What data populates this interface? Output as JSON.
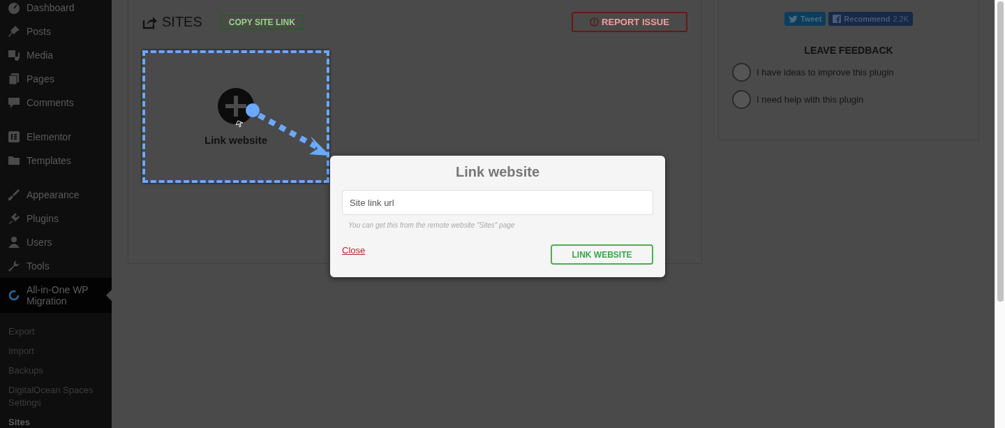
{
  "sidebar": {
    "menu_groups": [
      [
        {
          "label": "Dashboard",
          "selected": false
        },
        {
          "label": "Posts",
          "selected": false
        },
        {
          "label": "Media",
          "selected": false
        },
        {
          "label": "Pages",
          "selected": false
        },
        {
          "label": "Comments",
          "selected": false
        }
      ],
      [
        {
          "label": "Elementor",
          "selected": false
        },
        {
          "label": "Templates",
          "selected": false
        }
      ],
      [
        {
          "label": "Appearance",
          "selected": false
        },
        {
          "label": "Plugins",
          "selected": false
        },
        {
          "label": "Users",
          "selected": false
        },
        {
          "label": "Tools",
          "selected": false
        },
        {
          "label": "All-in-One WP Migration",
          "selected": true
        }
      ]
    ],
    "submenu": [
      {
        "label": "Export",
        "selected": false
      },
      {
        "label": "Import",
        "selected": false
      },
      {
        "label": "Backups",
        "selected": false
      },
      {
        "label": "DigitalOcean Spaces Settings",
        "selected": false
      },
      {
        "label": "Sites",
        "selected": true
      }
    ]
  },
  "sites_panel": {
    "title": "SITES",
    "copy_button": "COPY SITE LINK",
    "report_button": "REPORT ISSUE",
    "link_card": {
      "label": "Link website"
    }
  },
  "feedback_panel": {
    "tweet_button": "Tweet",
    "recommend_button": "Recommend",
    "recommend_count": "2.2K",
    "title": "LEAVE FEEDBACK",
    "options": [
      {
        "label": "I have ideas to improve this plugin",
        "selected": false
      },
      {
        "label": "I need help with this plugin",
        "selected": false
      }
    ]
  },
  "modal": {
    "title": "Link website",
    "input": {
      "placeholder": "Site link url"
    },
    "hint": "You can get this from the remote website \"Sites\" page",
    "close_link": "Close",
    "submit_button": "LINK WEBSITE"
  }
}
